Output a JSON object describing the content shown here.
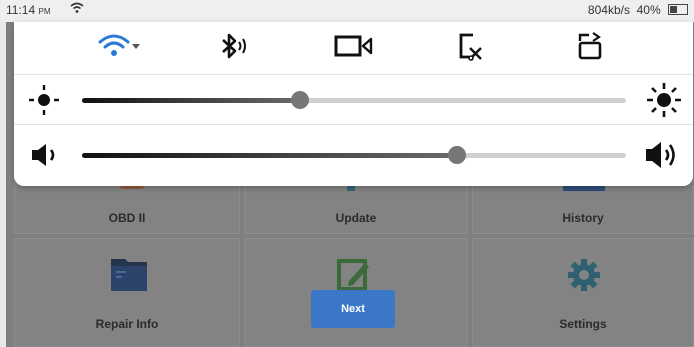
{
  "statusbar": {
    "time": "11:14",
    "ampm": "PM",
    "speed": "804kb/s",
    "battery": "40%"
  },
  "apps": [
    {
      "label": "OBD II"
    },
    {
      "label": "Update"
    },
    {
      "label": "History"
    },
    {
      "label": "Repair Info"
    },
    {
      "label": "Settings"
    }
  ],
  "quick_settings": {
    "toggles": [
      "wifi-icon",
      "bluetooth-icon",
      "screen-record-icon",
      "screenshot-icon",
      "rotate-icon"
    ],
    "brightness": 0.4,
    "volume": 0.69
  },
  "next_button": {
    "label": "Next"
  }
}
